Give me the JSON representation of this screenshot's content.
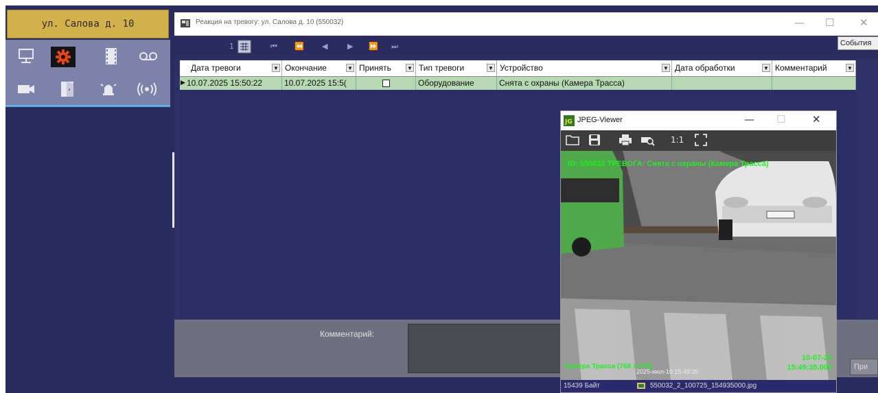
{
  "address_panel": {
    "label": "ул. Салова д. 10"
  },
  "left_icons": [
    "monitor-icon",
    "settings-gear-icon",
    "film-icon",
    "voicemail-icon",
    "camera-icon",
    "door-icon",
    "alarm-bell-icon",
    "radio-signal-icon"
  ],
  "main_window": {
    "title": "Реакция на тревогу: ул. Салова д. 10 (550032)",
    "toolbar": {
      "page_number": "1",
      "nav_buttons": [
        "first-icon",
        "prev-page-icon",
        "prev-icon",
        "next-icon",
        "next-page-icon",
        "last-icon"
      ]
    },
    "events_button": "События",
    "grid": {
      "columns": [
        "Дата тревоги",
        "Окончание",
        "Принять",
        "Тип тревоги",
        "Устройство",
        "Дата обработки",
        "Комментарий"
      ],
      "rows": [
        {
          "alarm_date": "10.07.2025 15:50:22",
          "end": "10.07.2025 15:5(",
          "accept": "",
          "alarm_type": "Оборудование",
          "device": "Снята с охраны (Камера Трасса)",
          "processed_date": "",
          "comment": ""
        }
      ]
    },
    "comment_label": "Комментарий:",
    "accept_button": "При"
  },
  "jpeg_viewer": {
    "title": "JPEG-Viewer",
    "tools": [
      "folder-icon",
      "save-icon",
      "print-icon",
      "print-preview-icon",
      "1:1",
      "fullscreen-icon"
    ],
    "overlay_top": "ID: 550032  ТРЕВОГА: Снята с охраны (Камера Трасса)",
    "overlay_bottom_left": "Камера Трасса (768 x 576)",
    "overlay_date": "10-07-25",
    "overlay_time": "15:49:35.000",
    "overlay_timestamp": "2025-июл-10 15:49:35",
    "status_size": "15439 Байт",
    "status_file": "550032_2_100725_154935000.jpg"
  },
  "colors": {
    "background": "#2a2c60",
    "address_bg": "#d3b14a",
    "active_icon": "#e8451c",
    "row_highlight": "#b7d9b2",
    "overlay_text": "#22ee22"
  }
}
